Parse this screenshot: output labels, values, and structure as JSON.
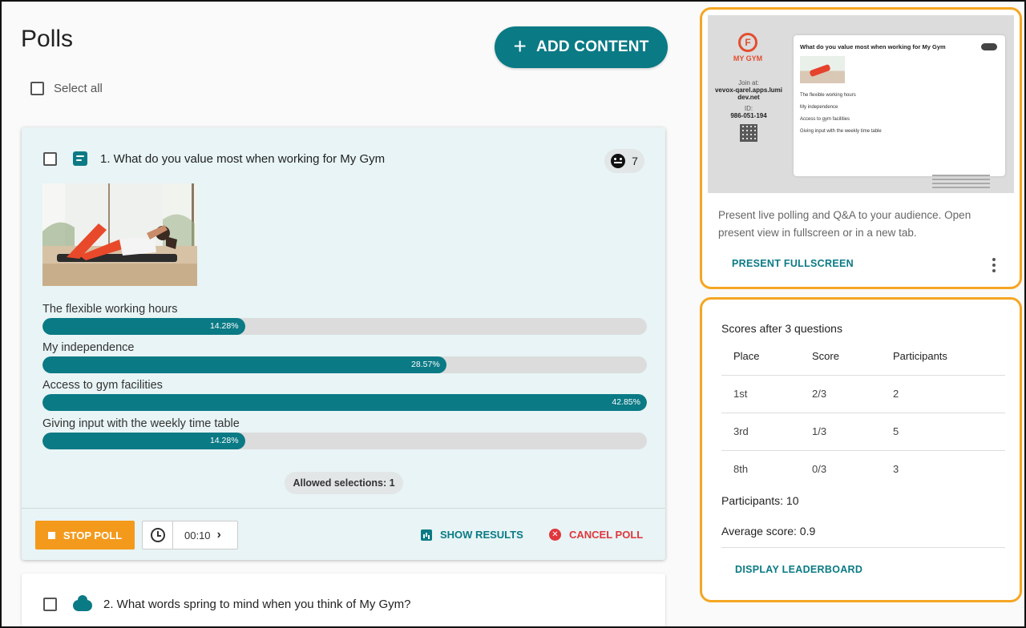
{
  "page": {
    "title": "Polls",
    "add_content_label": "ADD CONTENT",
    "select_all_label": "Select all"
  },
  "poll1": {
    "title": "1. What do you value most when working for My Gym",
    "response_count": "7",
    "options": [
      {
        "label": "The flexible working hours",
        "percent_text": "14.28%",
        "percent": 14.28
      },
      {
        "label": "My independence",
        "percent_text": "28.57%",
        "percent": 28.57
      },
      {
        "label": "Access to gym facilities",
        "percent_text": "42.85%",
        "percent": 42.85
      },
      {
        "label": "Giving input with the weekly time table",
        "percent_text": "14.28%",
        "percent": 14.28
      }
    ],
    "allowed_selections": "Allowed selections: 1",
    "stop_label": "STOP POLL",
    "timer": "00:10",
    "show_results_label": "SHOW RESULTS",
    "cancel_label": "CANCEL POLL"
  },
  "poll2": {
    "title": "2. What words spring to mind when you think of My Gym?"
  },
  "present": {
    "preview": {
      "logo_text": "MY GYM",
      "join_label": "Join at:",
      "join_url": "vevox-qarel.apps.lumidev.net",
      "id_label": "ID:",
      "id_value": "986-051-194",
      "slide_title": "What do you value most when working for My Gym",
      "slide_options": [
        "The flexible working hours",
        "My independence",
        "Access to gym facilities",
        "Giving input with the weekly time table"
      ]
    },
    "description": "Present live polling and Q&A to your audience. Open present view in fullscreen or in a new tab.",
    "fullscreen_label": "PRESENT FULLSCREEN"
  },
  "scores": {
    "title": "Scores after 3 questions",
    "headers": [
      "Place",
      "Score",
      "Participants"
    ],
    "rows": [
      [
        "1st",
        "2/3",
        "2"
      ],
      [
        "3rd",
        "1/3",
        "5"
      ],
      [
        "8th",
        "0/3",
        "3"
      ]
    ],
    "participants": "Participants: 10",
    "average": "Average score: 0.9",
    "leaderboard_label": "DISPLAY LEADERBOARD"
  },
  "colors": {
    "accent": "#0a7a85",
    "highlight": "#f5a623",
    "stop": "#f39a1c",
    "cancel": "#e0363c"
  }
}
